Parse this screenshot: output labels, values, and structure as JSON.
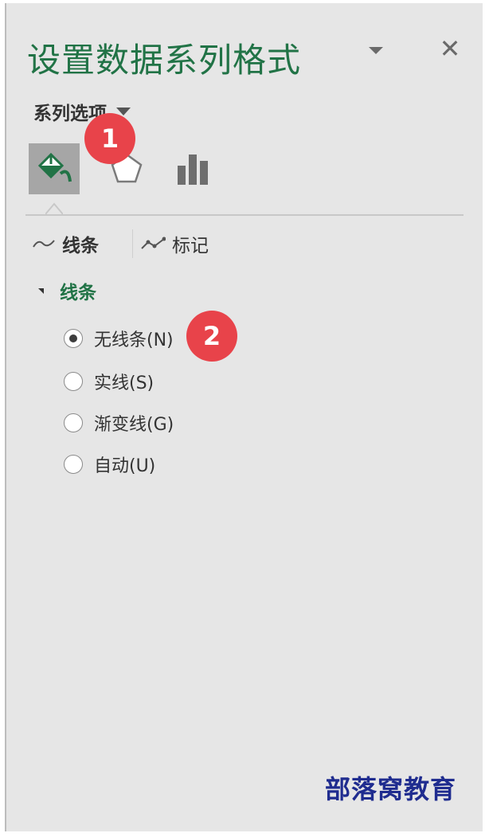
{
  "pane": {
    "title": "设置数据系列格式",
    "series_options_label": "系列选项",
    "tabs": [
      {
        "icon": "fill-line-icon",
        "selected": true
      },
      {
        "icon": "effects-pentagon-icon",
        "selected": false
      },
      {
        "icon": "series-options-bar-icon",
        "selected": false
      }
    ],
    "subtabs": {
      "line_label": "线条",
      "marker_label": "标记"
    },
    "section_label": "线条",
    "radio_options": [
      {
        "label": "无线条(N)",
        "checked": true
      },
      {
        "label": "实线(S)",
        "checked": false
      },
      {
        "label": "渐变线(G)",
        "checked": false
      },
      {
        "label": "自动(U)",
        "checked": false
      }
    ]
  },
  "annotations": {
    "badge1": "1",
    "badge2": "2"
  },
  "watermark": "部落窝教育",
  "colors": {
    "accent_green": "#217346",
    "pane_bg": "#e6e6e6",
    "badge_red": "#e8434a",
    "watermark_blue": "#1f2c8f"
  }
}
